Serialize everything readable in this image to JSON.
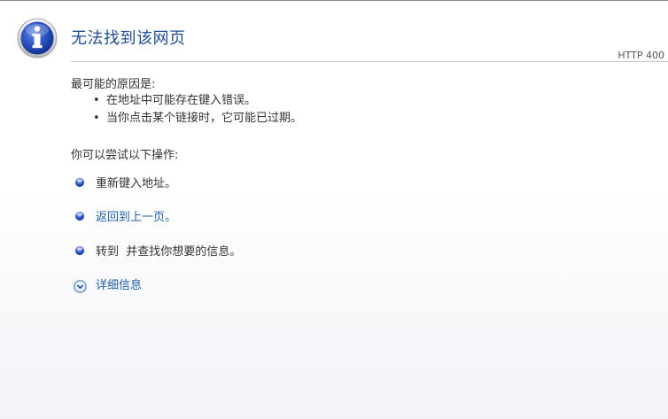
{
  "page": {
    "title": "无法找到该网页",
    "http_status": "HTTP 400"
  },
  "causes": {
    "heading": "最可能的原因是:",
    "items": [
      "在地址中可能存在键入错误。",
      "当你点击某个链接时，它可能已过期。"
    ]
  },
  "actions": {
    "heading": "你可以尝试以下操作:",
    "items": [
      {
        "label": "重新键入地址。",
        "link": false
      },
      {
        "label": "返回到上一页。",
        "link": true
      },
      {
        "label": "转到  并查找你想要的信息。",
        "link": false
      }
    ]
  },
  "details": {
    "label": "详细信息"
  },
  "colors": {
    "title": "#1f4e93",
    "link": "#1f5fa8",
    "icon_blue": "#2a4fb8"
  },
  "icons": {
    "main": "info-icon",
    "bullet": "blue-dot-icon",
    "expand": "chevron-down-circle-icon"
  }
}
